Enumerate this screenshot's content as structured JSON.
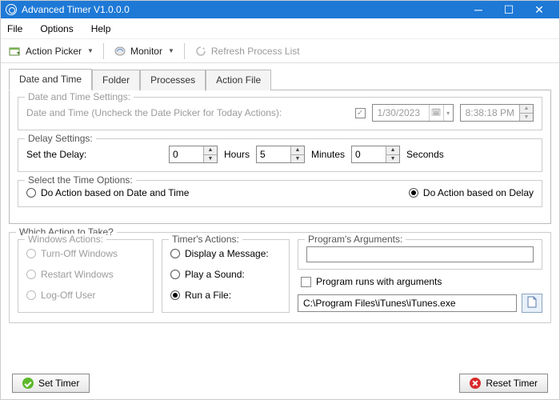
{
  "window": {
    "title": "Advanced Timer V1.0.0.0"
  },
  "menubar": {
    "file": "File",
    "options": "Options",
    "help": "Help"
  },
  "toolbar": {
    "action_picker": "Action Picker",
    "monitor": "Monitor",
    "refresh": "Refresh Process List"
  },
  "tabs": {
    "date_time": "Date and Time",
    "folder": "Folder",
    "processes": "Processes",
    "action_file": "Action File"
  },
  "datetime_group": {
    "legend": "Date and Time Settings:",
    "label": "Date and Time (Uncheck the Date Picker for Today Actions):",
    "date_value": "1/30/2023",
    "time_value": "8:38:18 PM"
  },
  "delay_group": {
    "legend": "Delay Settings:",
    "label": "Set the Delay:",
    "hours_value": "0",
    "hours_label": "Hours",
    "minutes_value": "5",
    "minutes_label": "Minutes",
    "seconds_value": "0",
    "seconds_label": "Seconds"
  },
  "time_options": {
    "legend": "Select the Time Options:",
    "by_datetime": "Do Action based on Date and Time",
    "by_delay": "Do Action based on Delay"
  },
  "action_group": {
    "legend": "Which Action to Take?",
    "windows_legend": "Windows Actions:",
    "win_turnoff": "Turn-Off Windows",
    "win_restart": "Restart Windows",
    "win_logoff": "Log-Off User",
    "timer_legend": "Timer's Actions:",
    "display_msg": "Display a Message:",
    "play_sound": "Play a Sound:",
    "run_file": "Run a File:",
    "args_legend": "Program's Arguments:",
    "args_value": "",
    "runs_with_args": "Program runs with arguments",
    "file_path": "C:\\Program Files\\iTunes\\iTunes.exe"
  },
  "footer": {
    "set": "Set Timer",
    "reset": "Reset Timer"
  }
}
